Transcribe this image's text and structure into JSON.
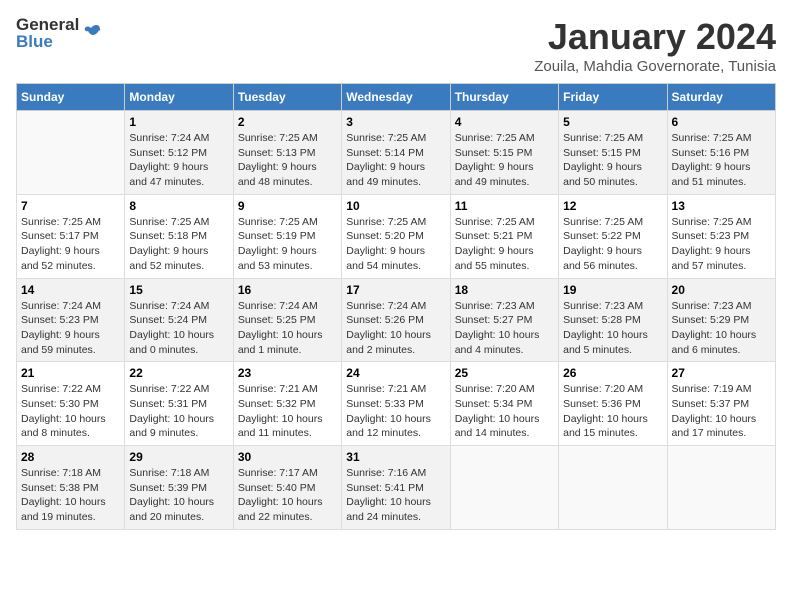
{
  "header": {
    "logo_general": "General",
    "logo_blue": "Blue",
    "title": "January 2024",
    "location": "Zouila, Mahdia Governorate, Tunisia"
  },
  "weekdays": [
    "Sunday",
    "Monday",
    "Tuesday",
    "Wednesday",
    "Thursday",
    "Friday",
    "Saturday"
  ],
  "weeks": [
    [
      {
        "day": "",
        "info": ""
      },
      {
        "day": "1",
        "info": "Sunrise: 7:24 AM\nSunset: 5:12 PM\nDaylight: 9 hours\nand 47 minutes."
      },
      {
        "day": "2",
        "info": "Sunrise: 7:25 AM\nSunset: 5:13 PM\nDaylight: 9 hours\nand 48 minutes."
      },
      {
        "day": "3",
        "info": "Sunrise: 7:25 AM\nSunset: 5:14 PM\nDaylight: 9 hours\nand 49 minutes."
      },
      {
        "day": "4",
        "info": "Sunrise: 7:25 AM\nSunset: 5:15 PM\nDaylight: 9 hours\nand 49 minutes."
      },
      {
        "day": "5",
        "info": "Sunrise: 7:25 AM\nSunset: 5:15 PM\nDaylight: 9 hours\nand 50 minutes."
      },
      {
        "day": "6",
        "info": "Sunrise: 7:25 AM\nSunset: 5:16 PM\nDaylight: 9 hours\nand 51 minutes."
      }
    ],
    [
      {
        "day": "7",
        "info": "Sunrise: 7:25 AM\nSunset: 5:17 PM\nDaylight: 9 hours\nand 52 minutes."
      },
      {
        "day": "8",
        "info": "Sunrise: 7:25 AM\nSunset: 5:18 PM\nDaylight: 9 hours\nand 52 minutes."
      },
      {
        "day": "9",
        "info": "Sunrise: 7:25 AM\nSunset: 5:19 PM\nDaylight: 9 hours\nand 53 minutes."
      },
      {
        "day": "10",
        "info": "Sunrise: 7:25 AM\nSunset: 5:20 PM\nDaylight: 9 hours\nand 54 minutes."
      },
      {
        "day": "11",
        "info": "Sunrise: 7:25 AM\nSunset: 5:21 PM\nDaylight: 9 hours\nand 55 minutes."
      },
      {
        "day": "12",
        "info": "Sunrise: 7:25 AM\nSunset: 5:22 PM\nDaylight: 9 hours\nand 56 minutes."
      },
      {
        "day": "13",
        "info": "Sunrise: 7:25 AM\nSunset: 5:23 PM\nDaylight: 9 hours\nand 57 minutes."
      }
    ],
    [
      {
        "day": "14",
        "info": "Sunrise: 7:24 AM\nSunset: 5:23 PM\nDaylight: 9 hours\nand 59 minutes."
      },
      {
        "day": "15",
        "info": "Sunrise: 7:24 AM\nSunset: 5:24 PM\nDaylight: 10 hours\nand 0 minutes."
      },
      {
        "day": "16",
        "info": "Sunrise: 7:24 AM\nSunset: 5:25 PM\nDaylight: 10 hours\nand 1 minute."
      },
      {
        "day": "17",
        "info": "Sunrise: 7:24 AM\nSunset: 5:26 PM\nDaylight: 10 hours\nand 2 minutes."
      },
      {
        "day": "18",
        "info": "Sunrise: 7:23 AM\nSunset: 5:27 PM\nDaylight: 10 hours\nand 4 minutes."
      },
      {
        "day": "19",
        "info": "Sunrise: 7:23 AM\nSunset: 5:28 PM\nDaylight: 10 hours\nand 5 minutes."
      },
      {
        "day": "20",
        "info": "Sunrise: 7:23 AM\nSunset: 5:29 PM\nDaylight: 10 hours\nand 6 minutes."
      }
    ],
    [
      {
        "day": "21",
        "info": "Sunrise: 7:22 AM\nSunset: 5:30 PM\nDaylight: 10 hours\nand 8 minutes."
      },
      {
        "day": "22",
        "info": "Sunrise: 7:22 AM\nSunset: 5:31 PM\nDaylight: 10 hours\nand 9 minutes."
      },
      {
        "day": "23",
        "info": "Sunrise: 7:21 AM\nSunset: 5:32 PM\nDaylight: 10 hours\nand 11 minutes."
      },
      {
        "day": "24",
        "info": "Sunrise: 7:21 AM\nSunset: 5:33 PM\nDaylight: 10 hours\nand 12 minutes."
      },
      {
        "day": "25",
        "info": "Sunrise: 7:20 AM\nSunset: 5:34 PM\nDaylight: 10 hours\nand 14 minutes."
      },
      {
        "day": "26",
        "info": "Sunrise: 7:20 AM\nSunset: 5:36 PM\nDaylight: 10 hours\nand 15 minutes."
      },
      {
        "day": "27",
        "info": "Sunrise: 7:19 AM\nSunset: 5:37 PM\nDaylight: 10 hours\nand 17 minutes."
      }
    ],
    [
      {
        "day": "28",
        "info": "Sunrise: 7:18 AM\nSunset: 5:38 PM\nDaylight: 10 hours\nand 19 minutes."
      },
      {
        "day": "29",
        "info": "Sunrise: 7:18 AM\nSunset: 5:39 PM\nDaylight: 10 hours\nand 20 minutes."
      },
      {
        "day": "30",
        "info": "Sunrise: 7:17 AM\nSunset: 5:40 PM\nDaylight: 10 hours\nand 22 minutes."
      },
      {
        "day": "31",
        "info": "Sunrise: 7:16 AM\nSunset: 5:41 PM\nDaylight: 10 hours\nand 24 minutes."
      },
      {
        "day": "",
        "info": ""
      },
      {
        "day": "",
        "info": ""
      },
      {
        "day": "",
        "info": ""
      }
    ]
  ]
}
